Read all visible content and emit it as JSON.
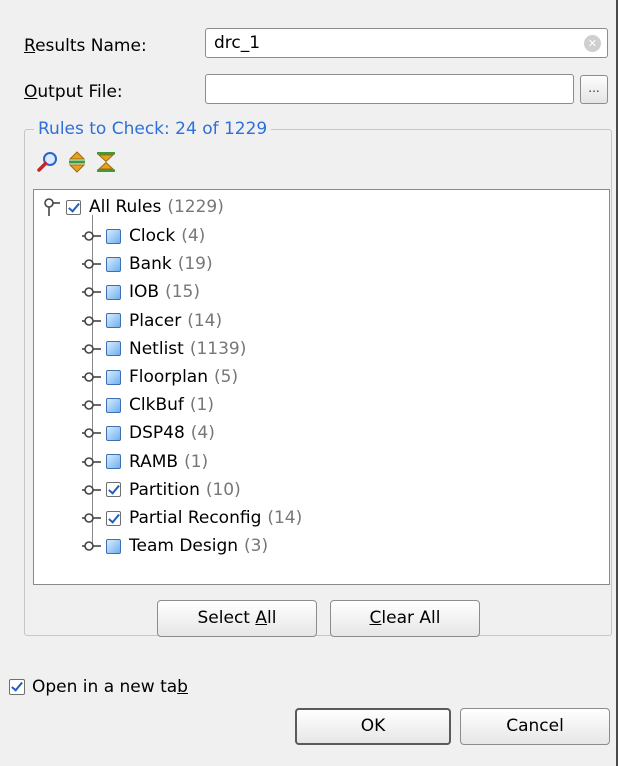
{
  "results_name": {
    "label_prefix": "",
    "label_mnemonic": "R",
    "label_rest": "esults Name:",
    "value": "drc_1",
    "clear_icon": "clear-icon"
  },
  "output_file": {
    "label_mnemonic": "O",
    "label_rest": "utput File:",
    "value": "",
    "browse_label": "..."
  },
  "rules_group": {
    "title": "Rules to Check: 24 of 1229",
    "toolbar_icons": [
      "search-icon",
      "expand-all-icon",
      "collapse-all-icon"
    ],
    "root": {
      "label": "All Rules",
      "count": "(1229)",
      "checked": true
    },
    "items": [
      {
        "label": "Clock",
        "count": "(4)",
        "checked": false
      },
      {
        "label": "Bank",
        "count": "(19)",
        "checked": false
      },
      {
        "label": "IOB",
        "count": "(15)",
        "checked": false
      },
      {
        "label": "Placer",
        "count": "(14)",
        "checked": false
      },
      {
        "label": "Netlist",
        "count": "(1139)",
        "checked": false
      },
      {
        "label": "Floorplan",
        "count": "(5)",
        "checked": false
      },
      {
        "label": "ClkBuf",
        "count": "(1)",
        "checked": false
      },
      {
        "label": "DSP48",
        "count": "(4)",
        "checked": false
      },
      {
        "label": "RAMB",
        "count": "(1)",
        "checked": false
      },
      {
        "label": "Partition",
        "count": "(10)",
        "checked": true
      },
      {
        "label": "Partial Reconfig",
        "count": "(14)",
        "checked": true
      },
      {
        "label": "Team Design",
        "count": "(3)",
        "checked": false
      }
    ],
    "select_all": {
      "pre": "Select ",
      "mnemonic": "A",
      "post": "ll"
    },
    "clear_all": {
      "pre": "",
      "mnemonic": "C",
      "post": "lear All"
    }
  },
  "open_new_tab": {
    "pre": "Open in a new ta",
    "mnemonic": "b",
    "checked": true
  },
  "footer": {
    "ok_label": "OK",
    "cancel_label": "Cancel"
  },
  "colors": {
    "group_title": "#2e6fd9",
    "count_text": "#777777",
    "checkbox_blue": "#6fb1ee"
  }
}
